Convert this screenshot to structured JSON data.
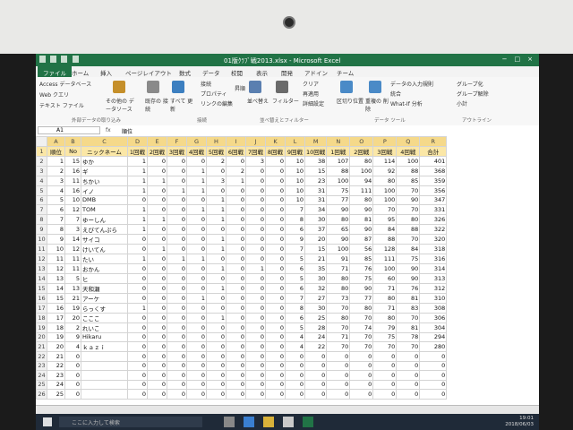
{
  "window": {
    "title": "01版ｸﾗﾌﾞ戦2013.xlsx - Microsoft Excel",
    "controls": [
      "−",
      "□",
      "×"
    ]
  },
  "tabs": [
    "ファイル",
    "ホーム",
    "挿入",
    "ページレイアウト",
    "数式",
    "データ",
    "校閲",
    "表示",
    "開発",
    "アドイン",
    "チーム"
  ],
  "ribbon": {
    "get_external": [
      "Access データベース",
      "Web クエリ",
      "テキスト ファイル"
    ],
    "other_sources": "その他の データソース",
    "existing": "既存の 接続",
    "refresh": "すべて 更新",
    "connections": [
      "接続",
      "プロパティ",
      "リンクの編集"
    ],
    "sort_az": "昇順",
    "sort": "並べ替え",
    "filter": "フィルター",
    "filter_opts": [
      "クリア",
      "再適用",
      "詳細設定"
    ],
    "text_to_cols": "区切り位置",
    "dup": "重複の 削除",
    "tools": [
      "データの入力規則",
      "統合",
      "What-If 分析"
    ],
    "outline": [
      "グループ化",
      "グループ解除",
      "小計"
    ],
    "groups": [
      "外部データの取り込み",
      "接続",
      "並べ替えとフィルター",
      "データ ツール",
      "アウトライン"
    ]
  },
  "formula_bar": {
    "namebox": "A1",
    "fx": "fx",
    "content": "順位"
  },
  "columns": [
    "A",
    "B",
    "C",
    "D",
    "E",
    "F",
    "G",
    "H",
    "I",
    "J",
    "K",
    "L",
    "M",
    "N",
    "O",
    "P",
    "Q",
    "R"
  ],
  "header_row": [
    "順位",
    "No",
    "ニックネーム",
    "1回戦",
    "2回戦",
    "3回戦",
    "4回戦",
    "5回戦",
    "6回戦",
    "7回戦",
    "8回戦",
    "9回戦",
    "10回戦",
    "1回戦",
    "2回戦",
    "3回戦",
    "4回戦",
    "合計"
  ],
  "rows": [
    [
      "1",
      "15",
      "ゆか",
      "1",
      "0",
      "0",
      "0",
      "2",
      "0",
      "3",
      "0",
      "10",
      "38",
      "107",
      "80",
      "114",
      "100",
      "401"
    ],
    [
      "2",
      "16",
      "ギ",
      "1",
      "0",
      "0",
      "1",
      "0",
      "2",
      "0",
      "0",
      "10",
      "15",
      "88",
      "100",
      "92",
      "88",
      "368"
    ],
    [
      "3",
      "11",
      "ちかい",
      "1",
      "1",
      "0",
      "1",
      "3",
      "1",
      "0",
      "0",
      "10",
      "23",
      "100",
      "94",
      "80",
      "85",
      "359"
    ],
    [
      "4",
      "16",
      "イノ",
      "1",
      "0",
      "1",
      "1",
      "0",
      "0",
      "0",
      "0",
      "10",
      "31",
      "75",
      "111",
      "100",
      "70",
      "356"
    ],
    [
      "5",
      "10",
      "DMB",
      "0",
      "0",
      "0",
      "0",
      "1",
      "0",
      "0",
      "0",
      "10",
      "31",
      "77",
      "80",
      "100",
      "90",
      "347"
    ],
    [
      "6",
      "12",
      "TOM",
      "1",
      "0",
      "0",
      "1",
      "1",
      "0",
      "0",
      "0",
      "7",
      "34",
      "90",
      "90",
      "70",
      "70",
      "331"
    ],
    [
      "7",
      "7",
      "ゆーしん",
      "1",
      "1",
      "0",
      "0",
      "1",
      "0",
      "0",
      "0",
      "8",
      "30",
      "80",
      "81",
      "95",
      "80",
      "326"
    ],
    [
      "8",
      "3",
      "えびてんぷら",
      "1",
      "0",
      "0",
      "0",
      "0",
      "0",
      "0",
      "0",
      "6",
      "37",
      "65",
      "90",
      "84",
      "88",
      "322"
    ],
    [
      "9",
      "14",
      "サイコ",
      "0",
      "0",
      "0",
      "0",
      "1",
      "0",
      "0",
      "0",
      "9",
      "20",
      "90",
      "87",
      "88",
      "70",
      "320"
    ],
    [
      "10",
      "12",
      "けいてん",
      "0",
      "1",
      "0",
      "0",
      "1",
      "0",
      "0",
      "0",
      "7",
      "15",
      "100",
      "56",
      "128",
      "84",
      "318"
    ],
    [
      "11",
      "11",
      "たい",
      "1",
      "0",
      "1",
      "1",
      "0",
      "0",
      "0",
      "0",
      "5",
      "21",
      "91",
      "85",
      "111",
      "75",
      "316"
    ],
    [
      "12",
      "11",
      "おかん",
      "0",
      "0",
      "0",
      "0",
      "1",
      "0",
      "1",
      "0",
      "6",
      "35",
      "71",
      "76",
      "100",
      "90",
      "314"
    ],
    [
      "13",
      "5",
      "ヒ",
      "0",
      "0",
      "0",
      "0",
      "0",
      "0",
      "0",
      "0",
      "5",
      "30",
      "80",
      "75",
      "60",
      "90",
      "313"
    ],
    [
      "14",
      "13",
      "天和瀬",
      "0",
      "0",
      "0",
      "0",
      "1",
      "0",
      "0",
      "0",
      "6",
      "32",
      "80",
      "90",
      "71",
      "76",
      "312"
    ],
    [
      "15",
      "21",
      "アーケ",
      "0",
      "0",
      "0",
      "1",
      "0",
      "0",
      "0",
      "0",
      "7",
      "27",
      "73",
      "77",
      "80",
      "81",
      "310"
    ],
    [
      "16",
      "19",
      "らっくす",
      "1",
      "0",
      "0",
      "0",
      "0",
      "0",
      "0",
      "0",
      "8",
      "30",
      "70",
      "80",
      "71",
      "83",
      "308"
    ],
    [
      "17",
      "20",
      "こここ",
      "0",
      "0",
      "0",
      "0",
      "1",
      "0",
      "0",
      "0",
      "6",
      "25",
      "80",
      "70",
      "80",
      "70",
      "306"
    ],
    [
      "18",
      "2",
      "れいこ",
      "0",
      "0",
      "0",
      "0",
      "0",
      "0",
      "0",
      "0",
      "5",
      "28",
      "70",
      "74",
      "79",
      "81",
      "304"
    ],
    [
      "19",
      "9",
      "Hikaru",
      "0",
      "0",
      "0",
      "0",
      "0",
      "0",
      "0",
      "0",
      "4",
      "24",
      "71",
      "70",
      "75",
      "78",
      "294"
    ],
    [
      "20",
      "4",
      "ｋａｚｉ",
      "0",
      "0",
      "0",
      "0",
      "0",
      "0",
      "0",
      "0",
      "4",
      "22",
      "70",
      "70",
      "70",
      "70",
      "280"
    ],
    [
      "21",
      "0",
      "",
      "0",
      "0",
      "0",
      "0",
      "0",
      "0",
      "0",
      "0",
      "0",
      "0",
      "0",
      "0",
      "0",
      "0",
      "0"
    ],
    [
      "22",
      "0",
      "",
      "0",
      "0",
      "0",
      "0",
      "0",
      "0",
      "0",
      "0",
      "0",
      "0",
      "0",
      "0",
      "0",
      "0",
      "0"
    ],
    [
      "23",
      "0",
      "",
      "0",
      "0",
      "0",
      "0",
      "0",
      "0",
      "0",
      "0",
      "0",
      "0",
      "0",
      "0",
      "0",
      "0",
      "0"
    ],
    [
      "24",
      "0",
      "",
      "0",
      "0",
      "0",
      "0",
      "0",
      "0",
      "0",
      "0",
      "0",
      "0",
      "0",
      "0",
      "0",
      "0",
      "0"
    ],
    [
      "25",
      "0",
      "",
      "0",
      "0",
      "0",
      "0",
      "0",
      "0",
      "0",
      "0",
      "0",
      "0",
      "0",
      "0",
      "0",
      "0",
      "0"
    ]
  ],
  "taskbar": {
    "search_placeholder": "ここに入力して検索",
    "time": "19:01",
    "date": "2018/06/03"
  },
  "colors": {
    "excel_green": "#217346",
    "header_fill": "#fbe7a6",
    "taskbar": "#1f2a38"
  }
}
